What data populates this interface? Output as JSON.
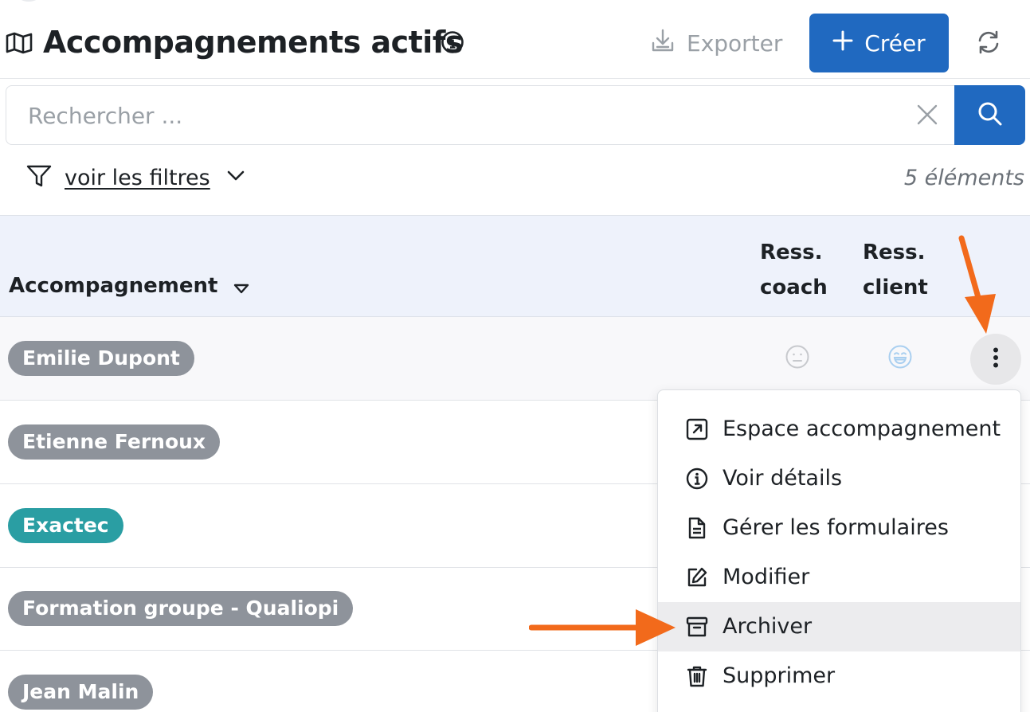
{
  "header": {
    "title": "Accompagnements actifs",
    "export_label": "Exporter",
    "create_label": "Créer"
  },
  "search": {
    "placeholder": "Rechercher ..."
  },
  "filters": {
    "toggle_label": "voir les filtres",
    "count": "5 éléments"
  },
  "table": {
    "columns": {
      "main": "Accompagnement",
      "coach_line1": "Ress.",
      "coach_line2": "coach",
      "client_line1": "Ress.",
      "client_line2": "client"
    },
    "rows": [
      {
        "name": "Emilie Dupont",
        "color": "#8e939b",
        "coach_icon": "neutral-face-icon",
        "client_icon": "grin-face-icon"
      },
      {
        "name": "Etienne Fernoux",
        "color": "#8e939b"
      },
      {
        "name": "Exactec",
        "color": "#2a9ea3"
      },
      {
        "name": "Formation groupe - Qualiopi",
        "color": "#8e939b"
      },
      {
        "name": "Jean Malin",
        "color": "#8e939b"
      }
    ]
  },
  "menu": {
    "items": [
      {
        "label": "Espace accompagnement",
        "icon": "external-link-icon"
      },
      {
        "label": "Voir détails",
        "icon": "info-circle-icon"
      },
      {
        "label": "Gérer les formulaires",
        "icon": "file-text-icon"
      },
      {
        "label": "Modifier",
        "icon": "edit-icon"
      },
      {
        "label": "Archiver",
        "icon": "archive-icon"
      },
      {
        "label": "Supprimer",
        "icon": "trash-icon"
      }
    ]
  },
  "colors": {
    "primary": "#2069c0",
    "annotation_arrow": "#f26a1b",
    "teal_pill": "#2a9ea3",
    "gray_pill": "#8e939b"
  }
}
